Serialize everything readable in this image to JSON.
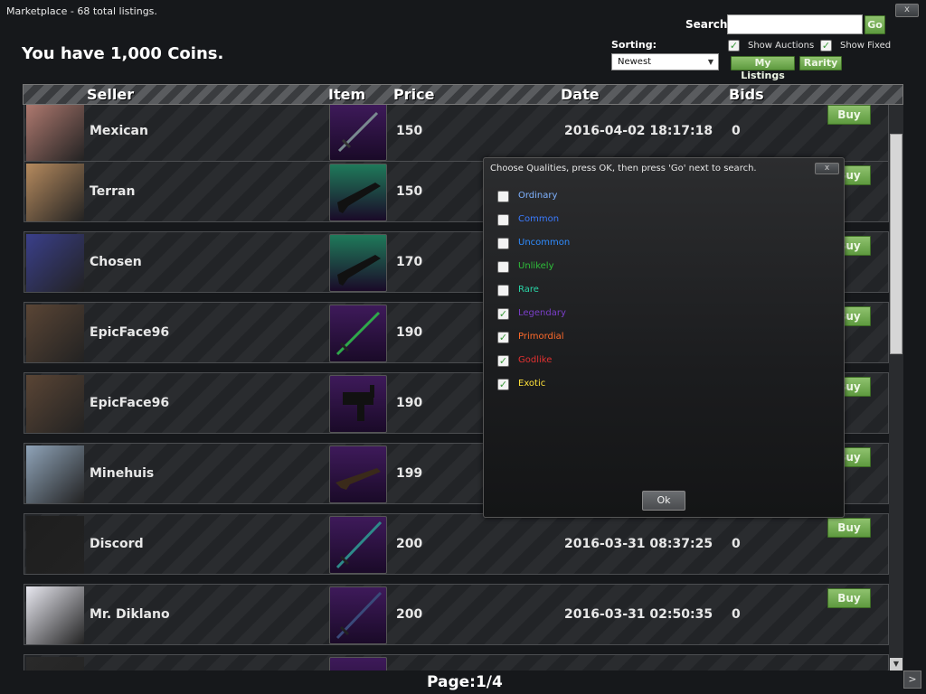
{
  "window": {
    "title": "Marketplace - 68 total listings.",
    "close_label": "x"
  },
  "coins_text": "You have 1,000 Coins.",
  "search": {
    "label": "Search:",
    "value": "",
    "placeholder": "",
    "go_label": "Go"
  },
  "sorting": {
    "label": "Sorting:",
    "selected": "Newest"
  },
  "filters": {
    "show_auctions": {
      "label": "Show Auctions",
      "checked": true
    },
    "show_fixed": {
      "label": "Show Fixed",
      "checked": true
    }
  },
  "buttons": {
    "my_listings": "My Listings",
    "rarity": "Rarity"
  },
  "columns": {
    "seller": "Seller",
    "item": "Item",
    "price": "Price",
    "date": "Date",
    "bids": "Bids"
  },
  "listings": [
    {
      "seller": "Mexican",
      "price": "150",
      "date": "2016-04-02 18:17:18",
      "bids": "0",
      "buy": "Buy",
      "item_color": "#3e1a5a",
      "item_icon": "sword-icon",
      "avatar_color": "#b07a70"
    },
    {
      "seller": "Terran",
      "price": "150",
      "date": "",
      "bids": "",
      "buy": "Buy",
      "item_color": "#1f7a5a",
      "item_icon": "rifle-icon",
      "avatar_color": "#b58a5e"
    },
    {
      "seller": "Chosen",
      "price": "170",
      "date": "",
      "bids": "",
      "buy": "Buy",
      "item_color": "#1f7a5a",
      "item_icon": "rifle-icon",
      "avatar_color": "#3a3f8a"
    },
    {
      "seller": "EpicFace96",
      "price": "190",
      "date": "",
      "bids": "",
      "buy": "Buy",
      "item_color": "#3e1a5a",
      "item_icon": "sword-icon",
      "avatar_color": "#5a4535"
    },
    {
      "seller": "EpicFace96",
      "price": "190",
      "date": "",
      "bids": "",
      "buy": "Buy",
      "item_color": "#3e1a5a",
      "item_icon": "smg-icon",
      "avatar_color": "#5a4535"
    },
    {
      "seller": "Minehuis",
      "price": "199",
      "date": "",
      "bids": "",
      "buy": "Buy",
      "item_color": "#3e1a5a",
      "item_icon": "rifle-icon",
      "avatar_color": "#8fa3b8"
    },
    {
      "seller": "Discord",
      "price": "200",
      "date": "2016-03-31 08:37:25",
      "bids": "0",
      "buy": "Buy",
      "item_color": "#3e1a5a",
      "item_icon": "sword-icon",
      "avatar_color": "#1e1e1e"
    },
    {
      "seller": "Mr. Diklano",
      "price": "200",
      "date": "2016-03-31 02:50:35",
      "bids": "0",
      "buy": "Buy",
      "item_color": "#3e1a5a",
      "item_icon": "sword-icon",
      "avatar_color": "#e8e8f0"
    },
    {
      "seller": "",
      "price": "",
      "date": "",
      "bids": "",
      "buy": "",
      "item_color": "#3e1a5a",
      "item_icon": "sword-icon",
      "avatar_color": "#2a2a2a"
    }
  ],
  "pagination": {
    "label": "Page:1/4",
    "next": ">"
  },
  "quality_dialog": {
    "title": "Choose Qualities, press OK, then press 'Go' next to search.",
    "close_label": "x",
    "ok_label": "Ok",
    "qualities": [
      {
        "label": "Ordinary",
        "checked": false,
        "color": "#7fb2ff"
      },
      {
        "label": "Common",
        "checked": false,
        "color": "#3b7bff"
      },
      {
        "label": "Uncommon",
        "checked": false,
        "color": "#2f8cff"
      },
      {
        "label": "Unlikely",
        "checked": false,
        "color": "#2fbf3a"
      },
      {
        "label": "Rare",
        "checked": false,
        "color": "#29d6a8"
      },
      {
        "label": "Legendary",
        "checked": true,
        "color": "#7a3ec8"
      },
      {
        "label": "Primordial",
        "checked": true,
        "color": "#ff6a2a"
      },
      {
        "label": "Godlike",
        "checked": true,
        "color": "#e23131"
      },
      {
        "label": "Exotic",
        "checked": true,
        "color": "#ffe23a"
      }
    ]
  }
}
